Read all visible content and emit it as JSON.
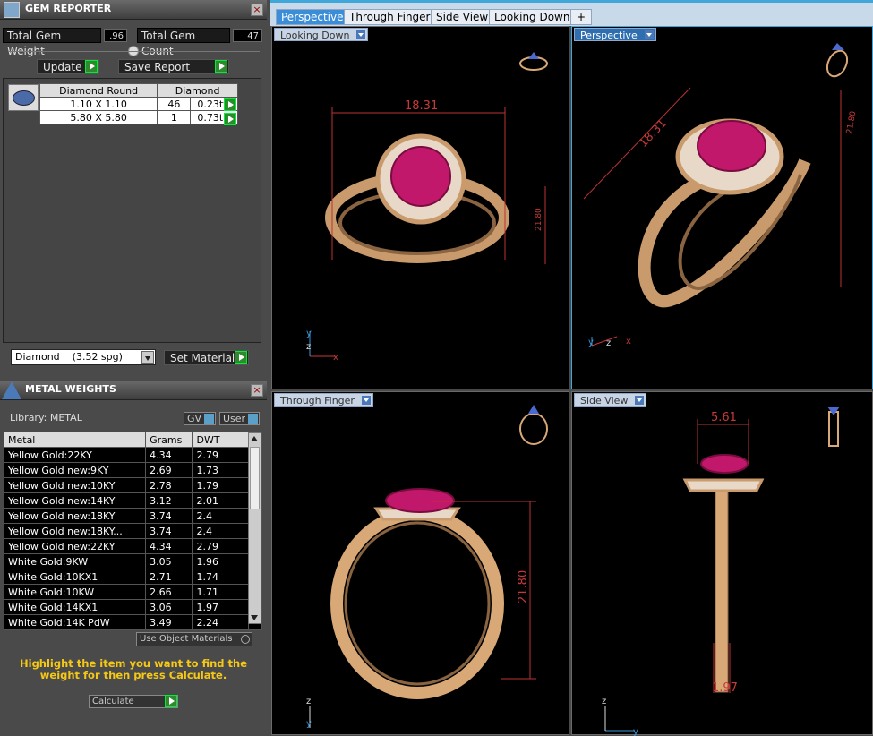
{
  "gem_reporter": {
    "title": "GEM REPORTER",
    "close": "×",
    "total_weight_label": "Total Gem Weight",
    "total_weight_value": ".96",
    "total_count_label": "Total Gem Count",
    "total_count_value": "47",
    "update_label": "Update",
    "save_report_label": "Save Report",
    "gem_header_left": "Diamond Round",
    "gem_header_right": "Diamond",
    "gems": [
      {
        "size": "1.10 X 1.10",
        "count": "46",
        "tw": "0.23tw"
      },
      {
        "size": "5.80 X 5.80",
        "count": "1",
        "tw": "0.73tw"
      }
    ],
    "material_select": "Diamond    (3.52 spg)",
    "set_material_label": "Set Material"
  },
  "metal_weights": {
    "title": "METAL WEIGHTS",
    "close": "×",
    "library_label": "Library: METAL",
    "gv_label": "GV",
    "user_label": "User",
    "columns": [
      "Metal",
      "Grams",
      "DWT"
    ],
    "rows": [
      [
        "Yellow Gold:22KY",
        "4.34",
        "2.79"
      ],
      [
        "Yellow Gold new:9KY",
        "2.69",
        "1.73"
      ],
      [
        "Yellow Gold new:10KY",
        "2.78",
        "1.79"
      ],
      [
        "Yellow Gold new:14KY",
        "3.12",
        "2.01"
      ],
      [
        "Yellow Gold new:18KY",
        "3.74",
        "2.4"
      ],
      [
        "Yellow Gold new:18KY...",
        "3.74",
        "2.4"
      ],
      [
        "Yellow Gold new:22KY",
        "4.34",
        "2.79"
      ],
      [
        "White Gold:9KW",
        "3.05",
        "1.96"
      ],
      [
        "White Gold:10KX1",
        "2.71",
        "1.74"
      ],
      [
        "White Gold:10KW",
        "2.66",
        "1.71"
      ],
      [
        "White Gold:14KX1",
        "3.06",
        "1.97"
      ],
      [
        "White Gold:14K PdW",
        "3.49",
        "2.24"
      ]
    ],
    "use_object_materials": "Use Object Materials",
    "hint": "Highlight the item you want to find the weight for then press Calculate.",
    "calculate_label": "Calculate"
  },
  "tabs": [
    "Perspective",
    "Through Finger",
    "Side View",
    "Looking Down",
    "+"
  ],
  "viewports": {
    "top_left": {
      "label": "Looking Down",
      "dim1": "18.31",
      "dim2": "21.80"
    },
    "top_right": {
      "label": "Perspective",
      "dim1": "18.31",
      "dim2": "21.80"
    },
    "bottom_left": {
      "label": "Through Finger",
      "dim1": "21.80"
    },
    "bottom_right": {
      "label": "Side View",
      "dim1": "5.61",
      "dim2": "1.97"
    }
  },
  "colors": {
    "gold": "#d9a877",
    "gem": "#c2186b",
    "dimension": "#c83a3a",
    "accent": "#3a8dd6"
  }
}
